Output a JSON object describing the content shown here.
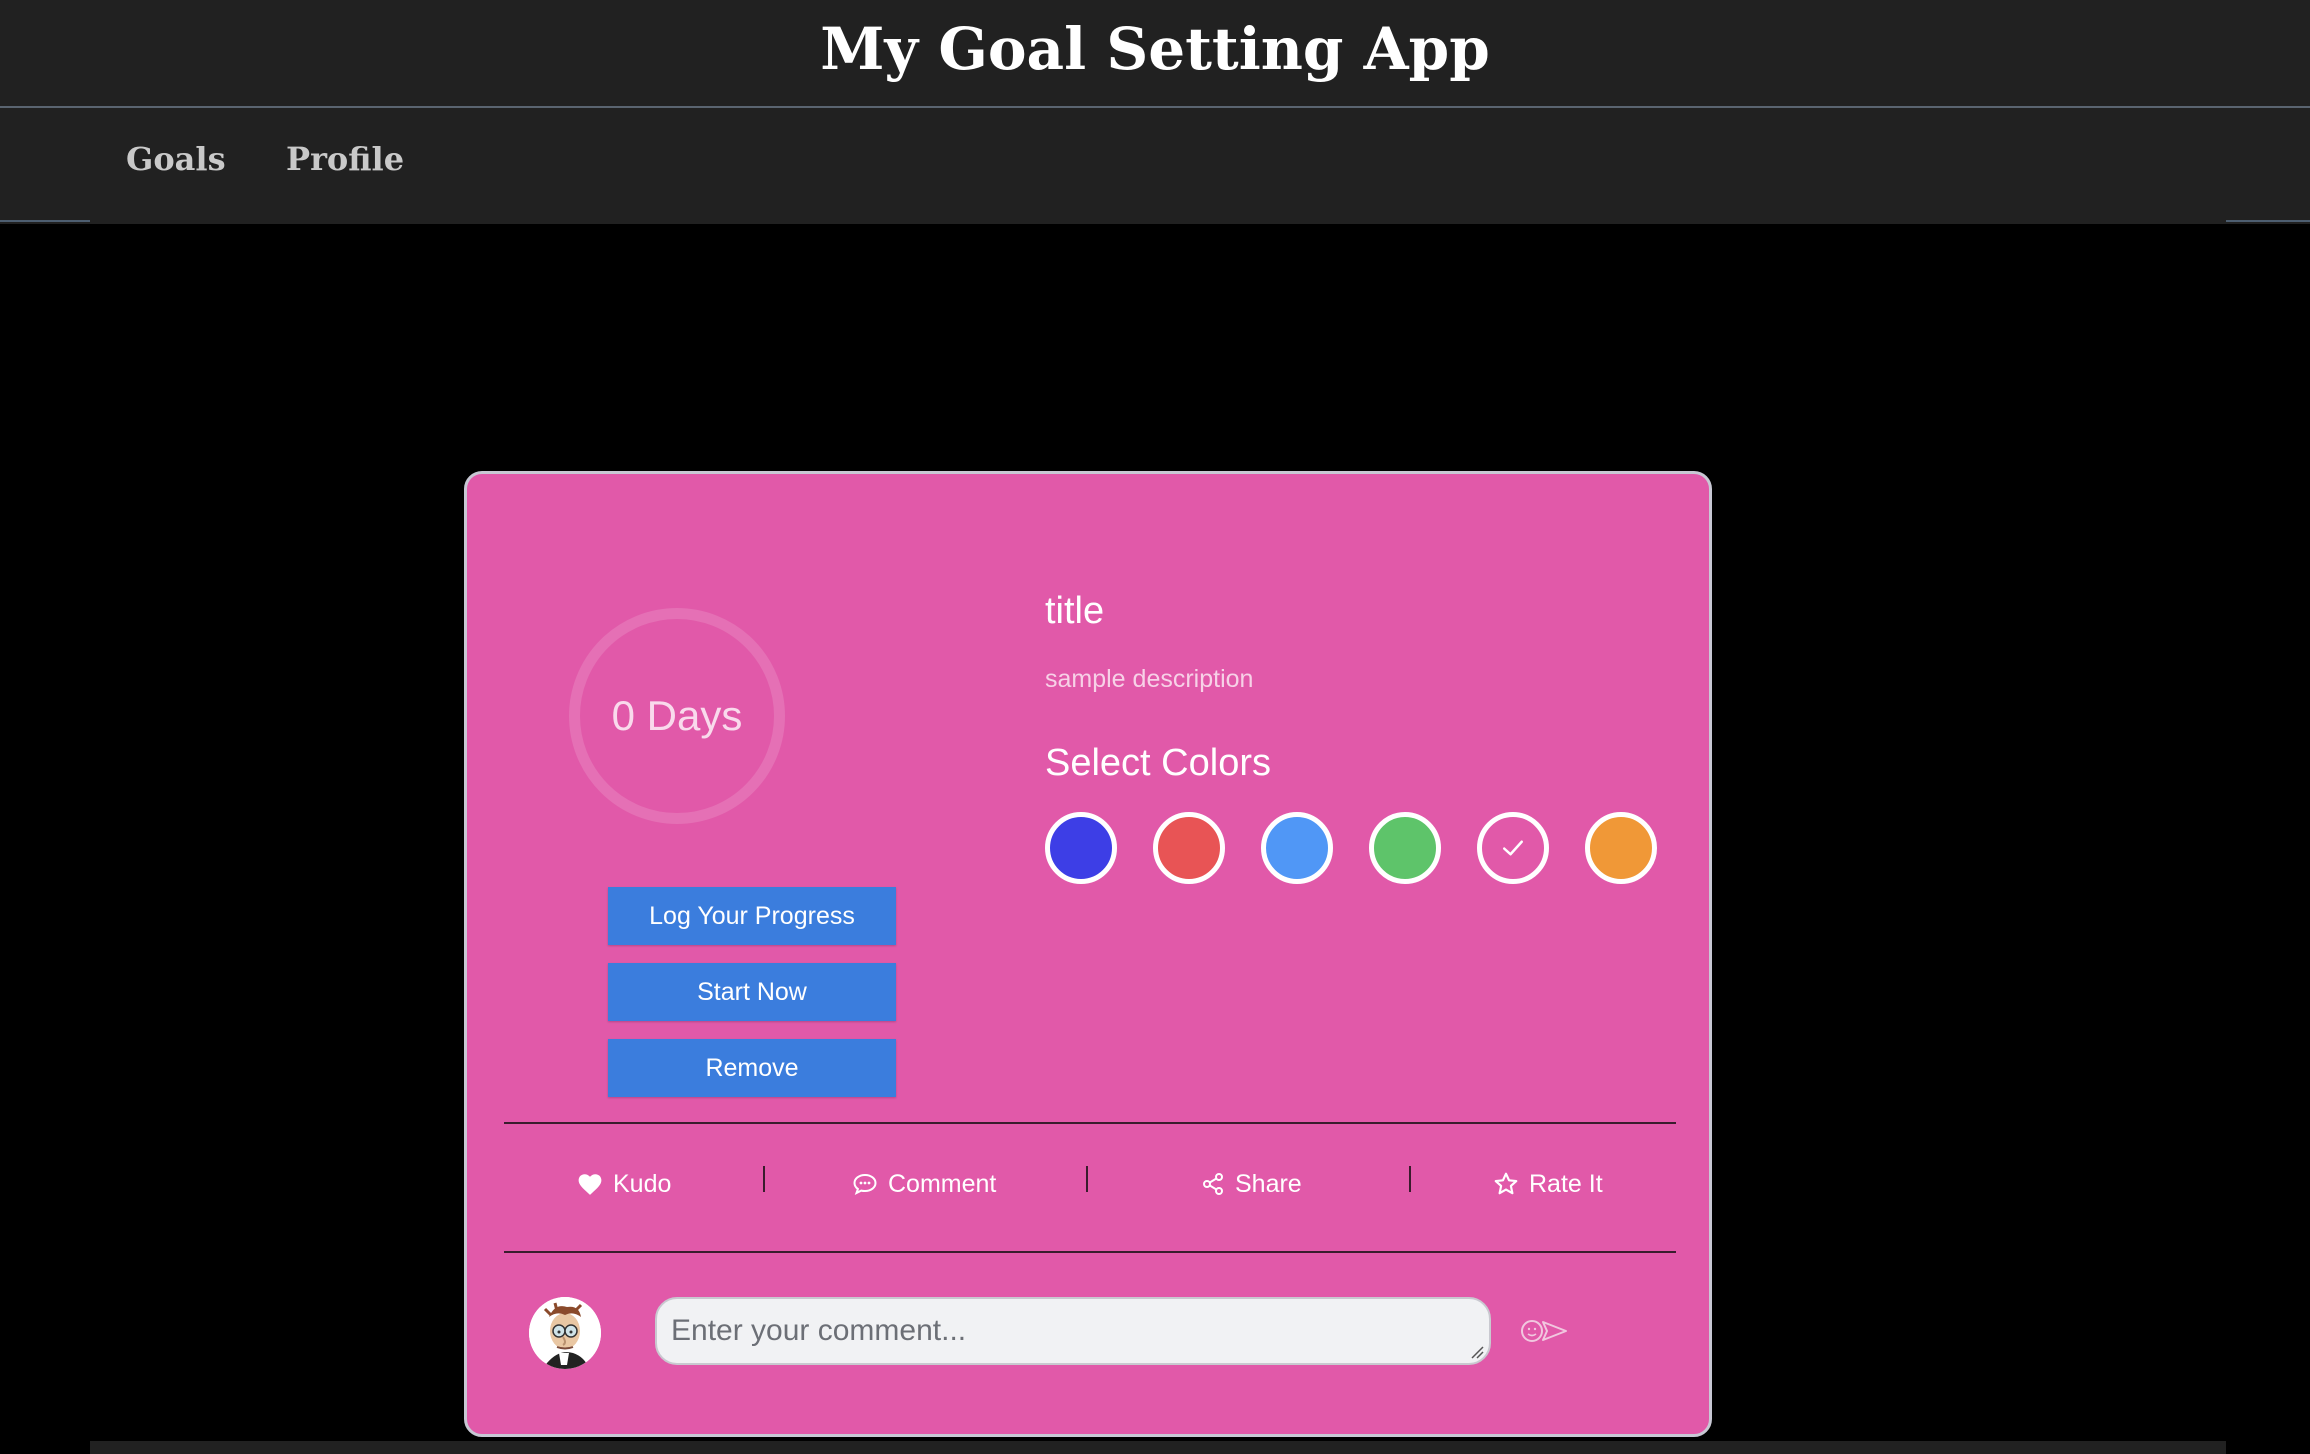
{
  "header": {
    "title": "My Goal Setting App"
  },
  "nav": {
    "goals": "Goals",
    "profile": "Profile"
  },
  "goal_card": {
    "days_label": "0 Days",
    "title": "title",
    "description": "sample description",
    "colors_heading": "Select Colors",
    "colors": [
      {
        "name": "blue",
        "hex": "#3d3ee6",
        "selected": false
      },
      {
        "name": "red",
        "hex": "#e85455",
        "selected": false
      },
      {
        "name": "light-blue",
        "hex": "#5097f6",
        "selected": false
      },
      {
        "name": "green",
        "hex": "#5ec46a",
        "selected": false
      },
      {
        "name": "pink",
        "hex": "#e159a9",
        "selected": true
      },
      {
        "name": "orange",
        "hex": "#f09837",
        "selected": false
      }
    ],
    "buttons": {
      "log_progress": "Log Your Progress",
      "start_now": "Start Now",
      "remove": "Remove"
    },
    "actions": {
      "kudo": "Kudo",
      "comment": "Comment",
      "share": "Share",
      "rate": "Rate It"
    },
    "comment_placeholder": "Enter your comment...",
    "accent_color": "#e159a9",
    "button_color": "#3b7ddd"
  },
  "icons": [
    "heart-icon",
    "comment-icon",
    "share-icon",
    "star-icon",
    "send-icon",
    "check-icon",
    "avatar-image"
  ]
}
